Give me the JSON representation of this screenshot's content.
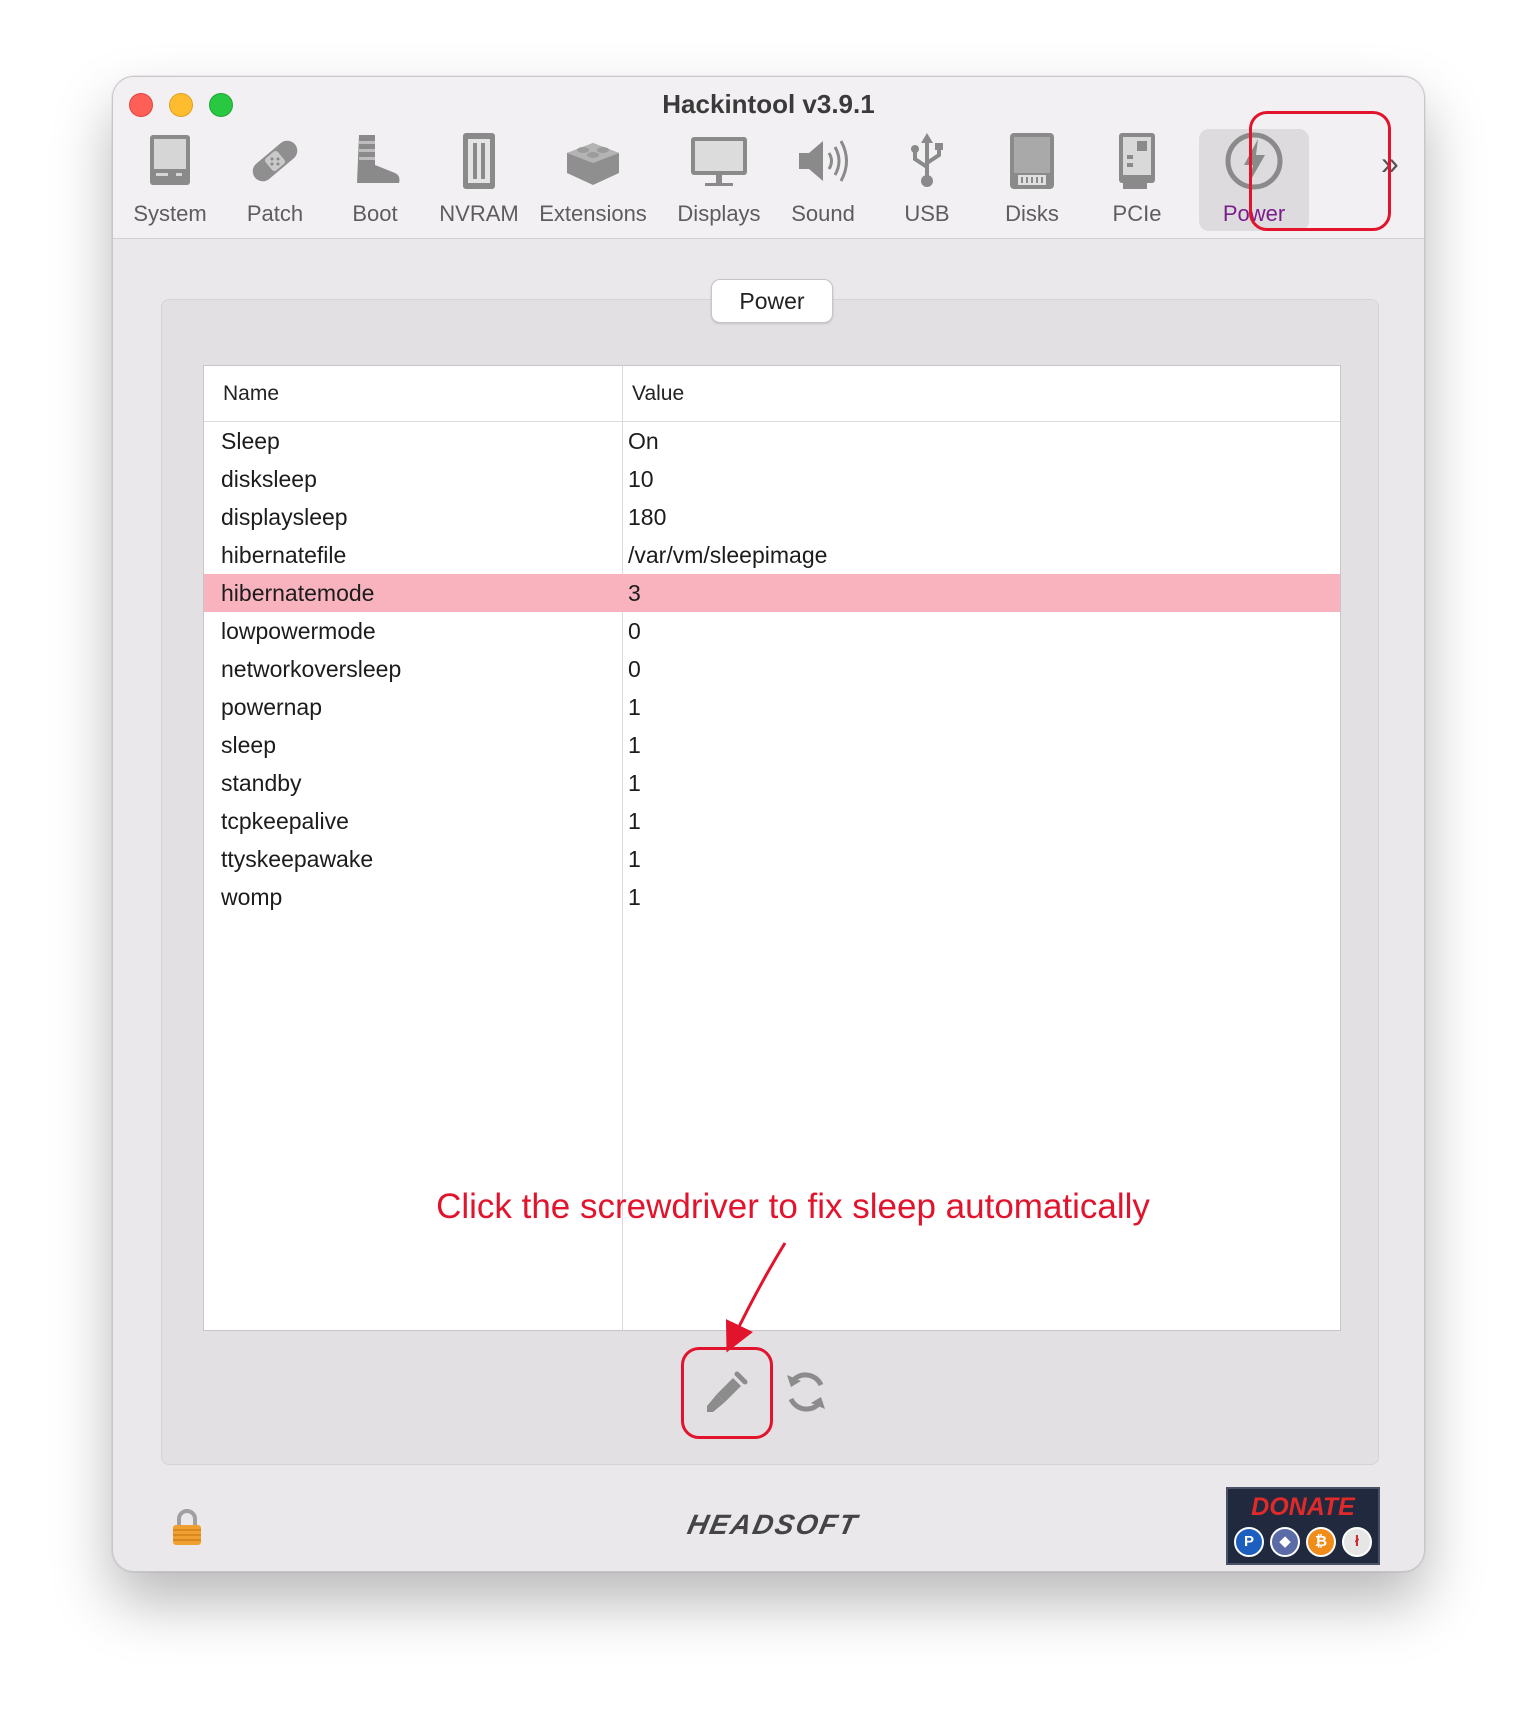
{
  "window": {
    "title": "Hackintool v3.9.1"
  },
  "toolbar": {
    "items": [
      {
        "label": "System",
        "icon": "system-icon"
      },
      {
        "label": "Patch",
        "icon": "patch-bandage-icon"
      },
      {
        "label": "Boot",
        "icon": "boot-icon"
      },
      {
        "label": "NVRAM",
        "icon": "nvram-chip-icon"
      },
      {
        "label": "Extensions",
        "icon": "lego-brick-icon"
      },
      {
        "label": "Displays",
        "icon": "monitor-icon"
      },
      {
        "label": "Sound",
        "icon": "speaker-icon"
      },
      {
        "label": "USB",
        "icon": "usb-icon"
      },
      {
        "label": "Disks",
        "icon": "disk-icon"
      },
      {
        "label": "PCIe",
        "icon": "pcie-card-icon"
      },
      {
        "label": "Power",
        "icon": "power-bolt-icon",
        "selected": true
      }
    ],
    "overflow_label": "»"
  },
  "section": {
    "tab_label": "Power"
  },
  "table": {
    "columns": [
      "Name",
      "Value"
    ],
    "rows": [
      {
        "name": "Sleep",
        "value": "On"
      },
      {
        "name": "disksleep",
        "value": "10"
      },
      {
        "name": "displaysleep",
        "value": "180"
      },
      {
        "name": "hibernatefile",
        "value": "/var/vm/sleepimage"
      },
      {
        "name": "hibernatemode",
        "value": "3",
        "selected": true
      },
      {
        "name": "lowpowermode",
        "value": "0"
      },
      {
        "name": "networkoversleep",
        "value": "0"
      },
      {
        "name": "powernap",
        "value": "1"
      },
      {
        "name": "sleep",
        "value": "1"
      },
      {
        "name": "standby",
        "value": "1"
      },
      {
        "name": "tcpkeepalive",
        "value": "1"
      },
      {
        "name": "ttyskeepawake",
        "value": "1"
      },
      {
        "name": "womp",
        "value": "1"
      }
    ]
  },
  "annotation": {
    "text": "Click the screwdriver to fix sleep automatically"
  },
  "actions": {
    "fix_icon": "screwdriver-icon",
    "refresh_icon": "refresh-icon"
  },
  "footer": {
    "lock_icon": "lock-icon",
    "brand": "HEADSOFT",
    "donate_label": "DONATE",
    "donate_coins": [
      "paypal-icon",
      "ethereum-icon",
      "bitcoin-icon",
      "litecoin-icon"
    ]
  },
  "colors": {
    "accent_selected_text": "#7b1e8c",
    "selected_row": "#f8b3bf",
    "annotation_red": "#e2142d"
  }
}
